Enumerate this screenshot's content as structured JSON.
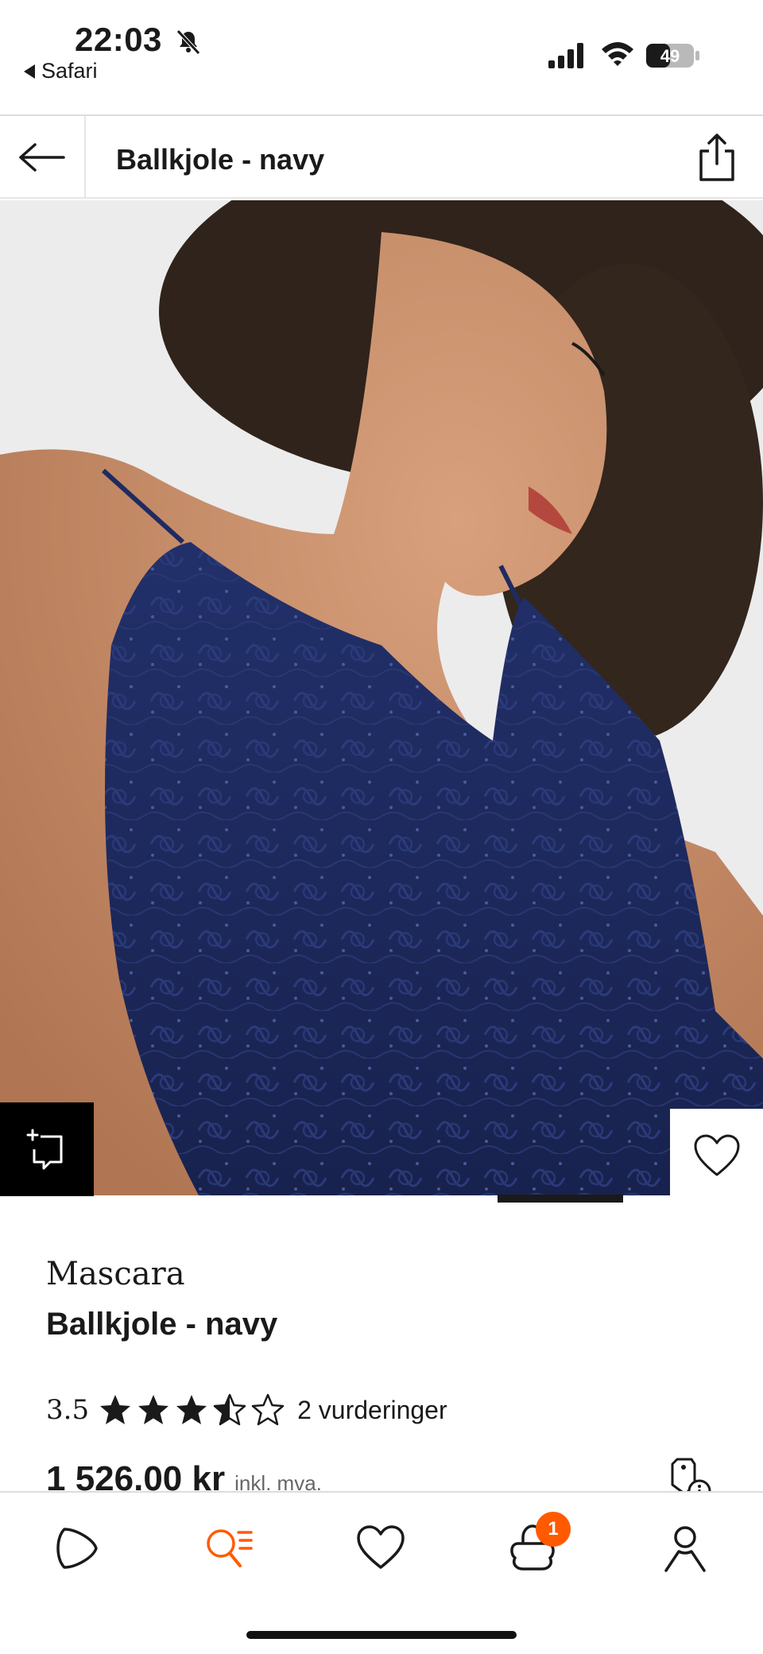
{
  "status_bar": {
    "time": "22:03",
    "back_app": "Safari",
    "battery": "49",
    "icons": [
      "bell-slash-icon",
      "signal-icon",
      "wifi-icon",
      "battery-icon"
    ]
  },
  "header": {
    "title": "Ballkjole - navy",
    "back_icon": "arrow-left-icon",
    "share_icon": "share-icon"
  },
  "hero": {
    "image_alt": "Model wearing navy lace ball gown",
    "try_on_icon": "ar-try-on-icon",
    "wishlist_icon": "heart-icon",
    "active_slide": 1
  },
  "product": {
    "brand": "Mascara",
    "name": "Ballkjole - navy",
    "rating": {
      "value": "3.5",
      "stars": 3.5,
      "max_stars": 5,
      "count_label": "2 vurderinger"
    },
    "price": "1 526.00 kr",
    "price_note": "inkl. mva.",
    "price_tag_icon": "price-tag-info-icon"
  },
  "bottom_nav": {
    "items": [
      {
        "name": "home",
        "icon": "play-logo-icon"
      },
      {
        "name": "search",
        "icon": "search-list-icon",
        "active": true
      },
      {
        "name": "wishlist",
        "icon": "heart-icon"
      },
      {
        "name": "cart",
        "icon": "bag-icon",
        "badge": "1"
      },
      {
        "name": "account",
        "icon": "person-icon"
      }
    ]
  },
  "colors": {
    "accent": "#ff5a00",
    "navy": "#1d2a5c",
    "text": "#1a1a1a"
  }
}
